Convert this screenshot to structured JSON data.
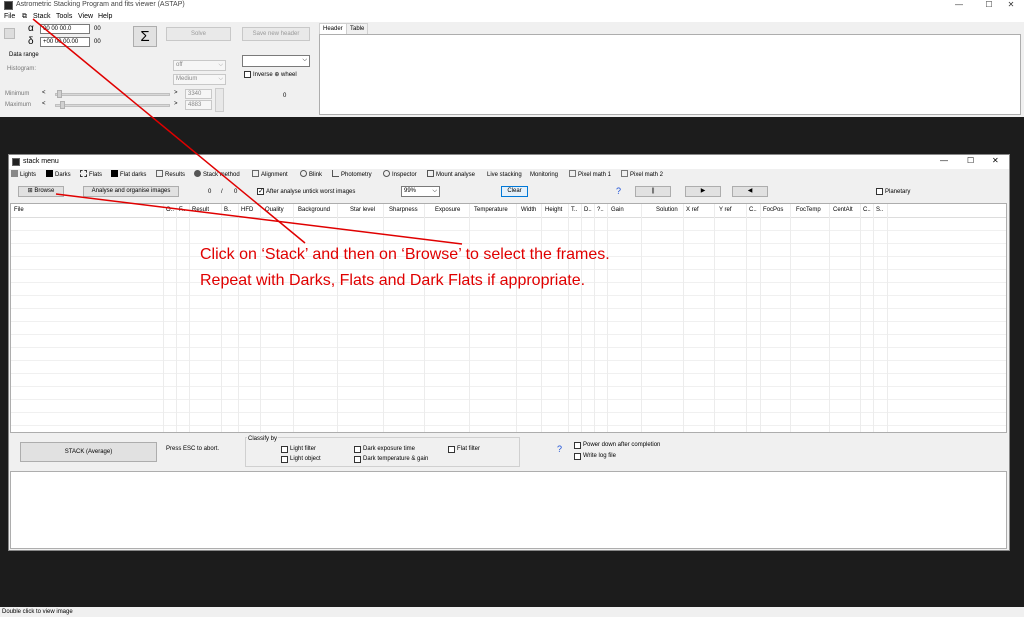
{
  "window": {
    "title": "Astrometric Stacking Program and fits viewer (ASTAP)",
    "minimize": "—",
    "maximize": "☐",
    "close": "✕"
  },
  "menubar": [
    "File",
    "Stack",
    "Tools",
    "View",
    "Help"
  ],
  "controls": {
    "alpha_symbol": "α",
    "delta_symbol": "δ",
    "ra_value": "00 00 00.0",
    "dec_value": "+00 00 00.00",
    "ra_suffix": "00",
    "dec_suffix": "00",
    "sigma_label": "Σ",
    "solve_label": "Solve",
    "save_header_label": "Save new header",
    "data_range_label": "Data range",
    "histogram_label": "Histogram:",
    "histogram_value": "off",
    "medium_value": "Medium",
    "inverse_label": "Inverse ⊕ wheel",
    "minimum_label": "Minimum",
    "maximum_label": "Maximum",
    "minimum_value": "3340",
    "maximum_value": "4883",
    "zero_value": "0",
    "slider_left": "<",
    "slider_right": ">"
  },
  "header_tabs": [
    "Header",
    "Table"
  ],
  "stack_window": {
    "title": "stack menu",
    "tabs": [
      "Lights",
      "Darks",
      "Flats",
      "Flat darks",
      "Results",
      "Stack method",
      "Alignment",
      "Blink",
      "Photometry",
      "Inspector",
      "Mount analyse",
      "Live stacking",
      "Monitoring",
      "Pixel math 1",
      "Pixel math 2"
    ],
    "browse_label": "Browse",
    "analyse_label": "Analyse and organise images",
    "count_done": "0",
    "count_sep": "/",
    "count_total": "0",
    "untick_label": "After analyse untick worst images",
    "percent_value": "99%",
    "clear_label": "Clear",
    "help_symbol": "?",
    "pause_symbol": "||",
    "play_symbol": "▶",
    "back_symbol": "◀",
    "planetary_label": "Planetary",
    "columns": [
      "File",
      "O..",
      "F..",
      "Result",
      "B..",
      "HFD",
      "Quality",
      "Background",
      "Star level",
      "Sharpness",
      "Exposure",
      "Temperature",
      "Width",
      "Height",
      "T..",
      "D..",
      "?..",
      "Gain",
      "Solution",
      "X ref",
      "Y ref",
      "C..",
      "FocPos",
      "FocTemp",
      "CentAlt",
      "C..",
      "S.."
    ],
    "stack_button": "STACK  (Average)",
    "esc_label": "Press ESC to abort.",
    "classify_label": "Classify by",
    "light_filter": "Light filter",
    "light_object": "Light object",
    "dark_exposure": "Dark exposure time",
    "dark_temp": "Dark temperature & gain",
    "flat_filter": "Flat filter",
    "power_down": "Power down after completion",
    "write_log": "Write log file"
  },
  "annotation": {
    "line1": "Click on ‘Stack’ and then on ‘Browse’ to select the frames.",
    "line2": "Repeat with Darks, Flats and Dark Flats if appropriate."
  },
  "status": "Double click to view image",
  "colors": {
    "annotation": "#e00000",
    "dark_background": "#1c1c1c"
  }
}
